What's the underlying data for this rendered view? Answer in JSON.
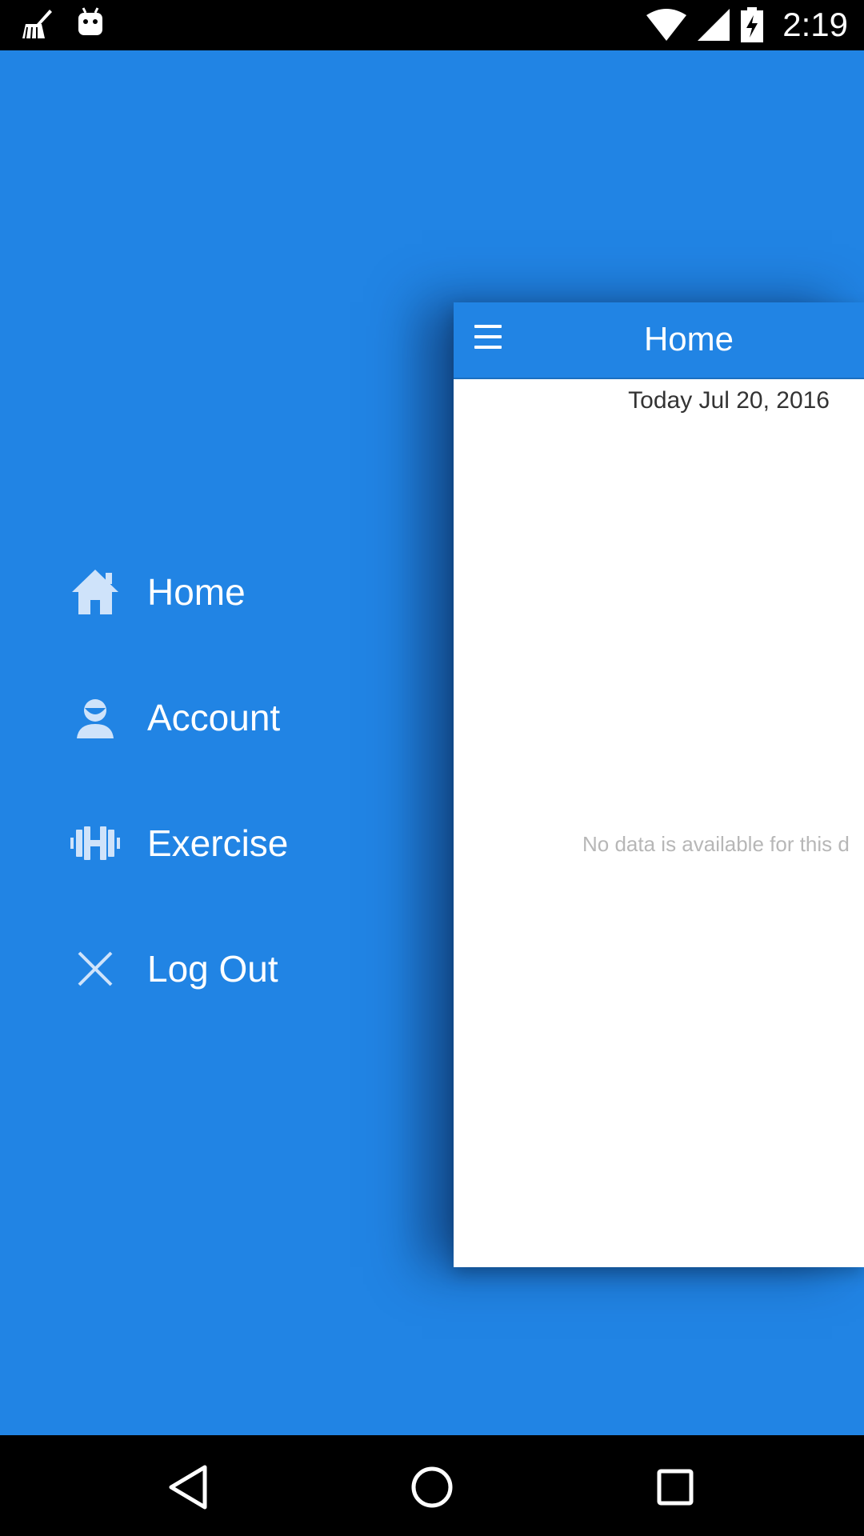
{
  "status_bar": {
    "time": "2:19",
    "icons": [
      "cleaner-icon",
      "android-icon",
      "wifi-icon",
      "signal-icon",
      "battery-charging-icon"
    ]
  },
  "drawer": {
    "items": [
      {
        "label": "Home",
        "icon": "home-icon"
      },
      {
        "label": "Account",
        "icon": "account-icon"
      },
      {
        "label": "Exercise",
        "icon": "dumbbell-icon"
      },
      {
        "label": "Log Out",
        "icon": "close-icon"
      }
    ]
  },
  "content": {
    "title": "Home",
    "date_text": "Today Jul 20, 2016",
    "empty_message": "No data is available for this d"
  },
  "nav_bar": {
    "icons": [
      "back-icon",
      "home-circle-icon",
      "recents-icon"
    ]
  },
  "colors": {
    "accent": "#2184e4",
    "card_bg": "#ffffff",
    "muted_text": "#b7b7b7"
  }
}
